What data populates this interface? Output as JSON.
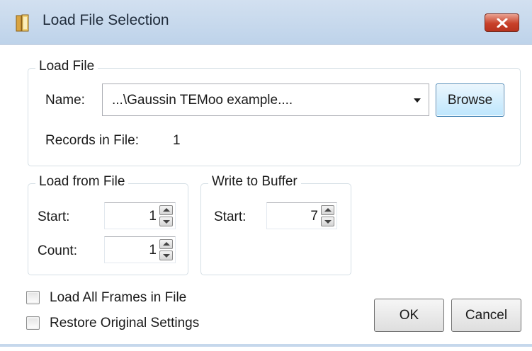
{
  "window": {
    "title": "Load File Selection",
    "close_icon": "close-x-icon",
    "app_icon": "book-icon",
    "close_color": "#c8412a"
  },
  "load_file": {
    "group_label": "Load File",
    "name_label": "Name:",
    "name_value": "...\\Gaussin TEMoo example....",
    "browse_label": "Browse",
    "records_label": "Records in File:",
    "records_value": "1"
  },
  "load_from_file": {
    "group_label": "Load from File",
    "start_label": "Start:",
    "start_value": "1",
    "count_label": "Count:",
    "count_value": "1"
  },
  "write_to_buffer": {
    "group_label": "Write to Buffer",
    "start_label": "Start:",
    "start_value": "7"
  },
  "options": {
    "load_all_label": "Load All Frames in File",
    "load_all_checked": false,
    "restore_label": "Restore Original Settings",
    "restore_checked": false
  },
  "buttons": {
    "ok_label": "OK",
    "cancel_label": "Cancel"
  }
}
